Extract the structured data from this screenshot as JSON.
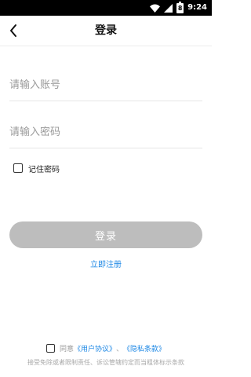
{
  "status_bar": {
    "time": "9:24",
    "battery_level": "8"
  },
  "header": {
    "title": "登录"
  },
  "form": {
    "account_placeholder": "请输入账号",
    "account_value": "",
    "password_placeholder": "请输入密码",
    "password_value": "",
    "remember_label": "记住密码",
    "remember_checked": false
  },
  "actions": {
    "login_label": "登录",
    "register_label": "立即注册"
  },
  "agreement": {
    "prefix": "同意",
    "user_agreement": "《用户协议》",
    "separator": "、",
    "privacy_terms": "《隐私条款》",
    "disclaimer": "接受免除或者限制责任、诉讼管辖约定而当粗体标示条款"
  },
  "colors": {
    "accent": "#1e88e5",
    "button_disabled": "#bdbdbd",
    "status_bar": "#000000"
  }
}
